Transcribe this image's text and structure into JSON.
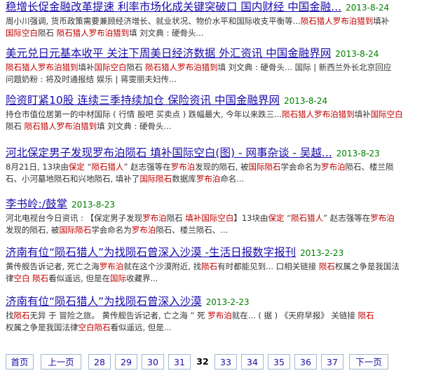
{
  "results": [
    {
      "title": "稳增长促金融改革提速 利率市场化成关键突破口 国内财经 中国金融...",
      "date": "2013-8-24",
      "lines": [
        [
          {
            "t": "周小川强调, 货币政策需要兼顾经济增长、就业状况、物价水平和国际收支平衡等..."
          },
          {
            "t": "陨石猎人罗布泊猎到",
            "h": true
          },
          {
            "t": "填补"
          }
        ],
        [
          {
            "t": "国际空白",
            "h": true
          },
          {
            "t": "陨石 "
          },
          {
            "t": "陨石猎人罗布泊猎到",
            "h": true
          },
          {
            "t": "填 刘文典 : 硬骨头..."
          }
        ]
      ]
    },
    {
      "title": "美元兑日元基本收平 关注下周美日经济数据 外汇资讯 中国金融界网",
      "date": "2013-8-24",
      "lines": [
        [
          {
            "t": "陨石猎人罗布泊猎到",
            "h": true
          },
          {
            "t": "填补"
          },
          {
            "t": "国际空白",
            "h": true
          },
          {
            "t": "陨石 "
          },
          {
            "t": "陨石猎人罗布泊猎到",
            "h": true
          },
          {
            "t": "填 刘文典 : 硬骨头... 国际 | 新西兰外长北京回应"
          }
        ],
        [
          {
            "t": "问题奶粉 : 将及时通报结 娱乐 | 蒋雯丽夫妇传..."
          }
        ]
      ]
    },
    {
      "title": "险资盯紧10股 连续三季持续加仓 保险资讯 中国金融界网",
      "date": "2013-8-24",
      "lines": [
        [
          {
            "t": "持仓市值位居第一的中材国际 ( 行情 股吧 买卖点 ) 跌幅最大, 今年以来跌三..."
          },
          {
            "t": "陨石猎人罗布泊猎到",
            "h": true
          },
          {
            "t": "填补"
          },
          {
            "t": "国际空白",
            "h": true
          }
        ],
        [
          {
            "t": " 陨石 "
          },
          {
            "t": "陨石猎人罗布泊猎到",
            "h": true
          },
          {
            "t": "填 刘文典 : 硬骨头..."
          }
        ]
      ]
    },
    {
      "title": "河北保定男子发现罗布泊陨石 填补国际空白(图) - 网事杂谈 - 吴越...",
      "date": "2013-8-23",
      "lines": [
        [
          {
            "t": "8月21日, 13块由"
          },
          {
            "t": "保定",
            "h": true
          },
          {
            "t": " “"
          },
          {
            "t": "陨石猎人",
            "h": true
          },
          {
            "t": "” 赵志强等在"
          },
          {
            "t": "罗布泊",
            "h": true
          },
          {
            "t": "发现的陨石, 被"
          },
          {
            "t": "国际陨石",
            "h": true
          },
          {
            "t": "学会命名为"
          },
          {
            "t": "罗布泊",
            "h": true
          },
          {
            "t": "陨石、楼兰陨"
          }
        ],
        [
          {
            "t": "石、小河墓地陨石和兴地陨石, 填补了"
          },
          {
            "t": "国际陨石",
            "h": true
          },
          {
            "t": "数据库"
          },
          {
            "t": "罗布泊",
            "h": true
          },
          {
            "t": "命名..."
          }
        ]
      ]
    },
    {
      "title": "李书岭:/鼓掌",
      "date": "2013-8-23",
      "lines": [
        [
          {
            "t": "河北电视台今日资讯 : 【保定男子发现"
          },
          {
            "t": "罗布泊",
            "h": true
          },
          {
            "t": "陨石 "
          },
          {
            "t": "填补国际空白",
            "h": true
          },
          {
            "t": "】13块由"
          },
          {
            "t": "保定",
            "h": true
          },
          {
            "t": " “"
          },
          {
            "t": "陨石猎人",
            "h": true
          },
          {
            "t": "” 赵志强等在"
          },
          {
            "t": "罗布泊",
            "h": true
          }
        ],
        [
          {
            "t": "发现的陨石, 被"
          },
          {
            "t": "国际陨石",
            "h": true
          },
          {
            "t": "学会命名为"
          },
          {
            "t": "罗布泊",
            "h": true
          },
          {
            "t": "陨石、楼兰陨石、..."
          }
        ]
      ]
    },
    {
      "title": "济南有位“陨石猎人”为找陨石曾深入沙漠 -生活日报数字报刊",
      "date": "2013-2-23",
      "lines": [
        [
          {
            "t": "黄传舰告诉记者, 死亡之海"
          },
          {
            "t": "罗布泊",
            "h": true
          },
          {
            "t": "就在这个沙漠附近, 找"
          },
          {
            "t": "陨石",
            "h": true
          },
          {
            "t": "有时都能见到... 口相关链接 "
          },
          {
            "t": "陨石",
            "h": true
          },
          {
            "t": "权属之争是我国法"
          }
        ],
        [
          {
            "t": "律"
          },
          {
            "t": "空白",
            "h": true
          },
          {
            "t": " "
          },
          {
            "t": "陨石",
            "h": true
          },
          {
            "t": "看似遥远, 但是在"
          },
          {
            "t": "国际",
            "h": true
          },
          {
            "t": "收藏界..."
          }
        ]
      ]
    },
    {
      "title": "济南有位“陨石猎人”为找陨石曾深入沙漠",
      "date": "2013-2-23",
      "lines": [
        [
          {
            "t": "找"
          },
          {
            "t": "陨石",
            "h": true
          },
          {
            "t": "无异 于 冒险之旅。 黄传舰告诉记者, 亡之海 ” 死 "
          },
          {
            "t": "罗布泊",
            "h": true
          },
          {
            "t": "就在... ( 据 ) 《天府早报》 关链接 "
          },
          {
            "t": "陨石",
            "h": true
          }
        ],
        [
          {
            "t": "权属之争是我国法律"
          },
          {
            "t": "空白",
            "h": true
          },
          {
            "t": "陨石",
            "h": true
          },
          {
            "t": "看似遥远, 但是..."
          }
        ]
      ]
    }
  ],
  "pagination": {
    "items": [
      {
        "label": "首页",
        "type": "first"
      },
      {
        "label": "上一页",
        "type": "prev"
      },
      {
        "label": "28"
      },
      {
        "label": "29"
      },
      {
        "label": "30"
      },
      {
        "label": "31"
      },
      {
        "label": "32",
        "current": true
      },
      {
        "label": "33"
      },
      {
        "label": "34"
      },
      {
        "label": "35"
      },
      {
        "label": "36"
      },
      {
        "label": "37"
      },
      {
        "label": "下一页",
        "type": "next"
      }
    ]
  }
}
